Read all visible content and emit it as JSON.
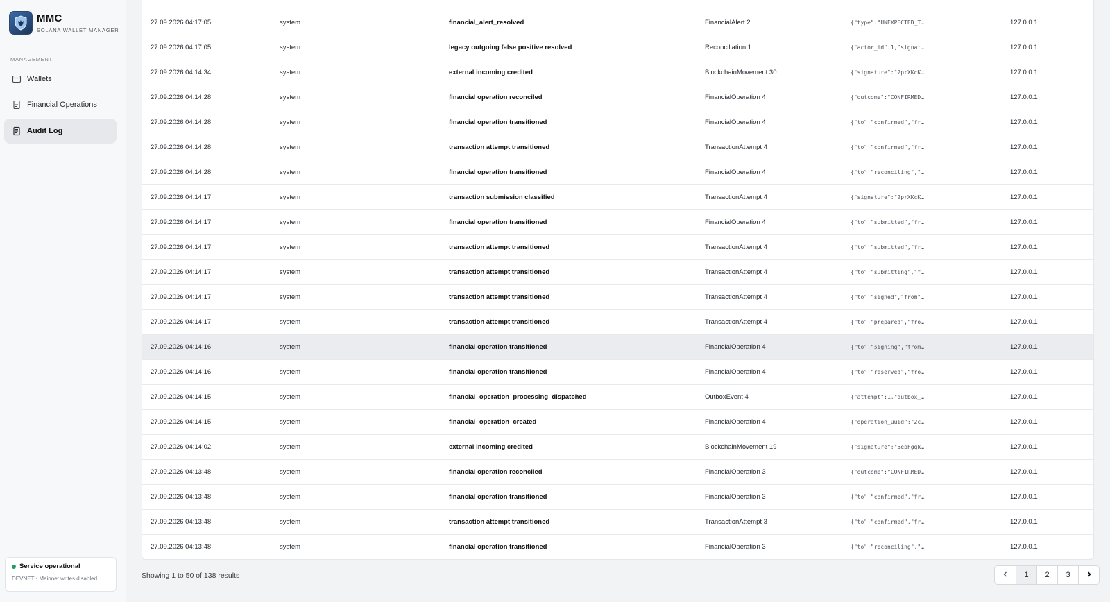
{
  "brand": {
    "title": "MMC",
    "subtitle": "SOLANA WALLET MANAGER",
    "logo_icon": "shield-beast-logo"
  },
  "sidebar": {
    "section_label": "MANAGEMENT",
    "items": [
      {
        "label": "Wallets",
        "icon": "wallet-icon",
        "active": false
      },
      {
        "label": "Financial Operations",
        "icon": "document-icon",
        "active": false
      },
      {
        "label": "Audit Log",
        "icon": "document-icon",
        "active": true
      }
    ]
  },
  "status": {
    "title": "Service operational",
    "subtitle": "DEVNET · Mainnet writes disabled",
    "dot_color": "#1e9e62"
  },
  "audit": {
    "rows": [
      {
        "time": "27.09.2026 04:17:05",
        "actor": "system",
        "action": "financial_alert_resolved",
        "subject": "FinancialAlert 2",
        "metadata": "{\"type\":\"UNEXPECTED_T…",
        "ip": "127.0.0.1"
      },
      {
        "time": "27.09.2026 04:17:05",
        "actor": "system",
        "action": "legacy outgoing false positive resolved",
        "subject": "Reconciliation 1",
        "metadata": "{\"actor_id\":1,\"signat…",
        "ip": "127.0.0.1"
      },
      {
        "time": "27.09.2026 04:14:34",
        "actor": "system",
        "action": "external incoming credited",
        "subject": "BlockchainMovement 30",
        "metadata": "{\"signature\":\"2prXKcK…",
        "ip": "127.0.0.1"
      },
      {
        "time": "27.09.2026 04:14:28",
        "actor": "system",
        "action": "financial operation reconciled",
        "subject": "FinancialOperation 4",
        "metadata": "{\"outcome\":\"CONFIRMED…",
        "ip": "127.0.0.1"
      },
      {
        "time": "27.09.2026 04:14:28",
        "actor": "system",
        "action": "financial operation transitioned",
        "subject": "FinancialOperation 4",
        "metadata": "{\"to\":\"confirmed\",\"fr…",
        "ip": "127.0.0.1"
      },
      {
        "time": "27.09.2026 04:14:28",
        "actor": "system",
        "action": "transaction attempt transitioned",
        "subject": "TransactionAttempt 4",
        "metadata": "{\"to\":\"confirmed\",\"fr…",
        "ip": "127.0.0.1"
      },
      {
        "time": "27.09.2026 04:14:28",
        "actor": "system",
        "action": "financial operation transitioned",
        "subject": "FinancialOperation 4",
        "metadata": "{\"to\":\"reconciling\",\"…",
        "ip": "127.0.0.1"
      },
      {
        "time": "27.09.2026 04:14:17",
        "actor": "system",
        "action": "transaction submission classified",
        "subject": "TransactionAttempt 4",
        "metadata": "{\"signature\":\"2prXKcK…",
        "ip": "127.0.0.1"
      },
      {
        "time": "27.09.2026 04:14:17",
        "actor": "system",
        "action": "financial operation transitioned",
        "subject": "FinancialOperation 4",
        "metadata": "{\"to\":\"submitted\",\"fr…",
        "ip": "127.0.0.1"
      },
      {
        "time": "27.09.2026 04:14:17",
        "actor": "system",
        "action": "transaction attempt transitioned",
        "subject": "TransactionAttempt 4",
        "metadata": "{\"to\":\"submitted\",\"fr…",
        "ip": "127.0.0.1"
      },
      {
        "time": "27.09.2026 04:14:17",
        "actor": "system",
        "action": "transaction attempt transitioned",
        "subject": "TransactionAttempt 4",
        "metadata": "{\"to\":\"submitting\",\"f…",
        "ip": "127.0.0.1"
      },
      {
        "time": "27.09.2026 04:14:17",
        "actor": "system",
        "action": "transaction attempt transitioned",
        "subject": "TransactionAttempt 4",
        "metadata": "{\"to\":\"signed\",\"from\"…",
        "ip": "127.0.0.1"
      },
      {
        "time": "27.09.2026 04:14:17",
        "actor": "system",
        "action": "transaction attempt transitioned",
        "subject": "TransactionAttempt 4",
        "metadata": "{\"to\":\"prepared\",\"fro…",
        "ip": "127.0.0.1"
      },
      {
        "time": "27.09.2026 04:14:16",
        "actor": "system",
        "action": "financial operation transitioned",
        "subject": "FinancialOperation 4",
        "metadata": "{\"to\":\"signing\",\"from…",
        "ip": "127.0.0.1",
        "highlight": true
      },
      {
        "time": "27.09.2026 04:14:16",
        "actor": "system",
        "action": "financial operation transitioned",
        "subject": "FinancialOperation 4",
        "metadata": "{\"to\":\"reserved\",\"fro…",
        "ip": "127.0.0.1"
      },
      {
        "time": "27.09.2026 04:14:15",
        "actor": "system",
        "action": "financial_operation_processing_dispatched",
        "subject": "OutboxEvent 4",
        "metadata": "{\"attempt\":1,\"outbox_…",
        "ip": "127.0.0.1"
      },
      {
        "time": "27.09.2026 04:14:15",
        "actor": "system",
        "action": "financial_operation_created",
        "subject": "FinancialOperation 4",
        "metadata": "{\"operation_uuid\":\"2c…",
        "ip": "127.0.0.1"
      },
      {
        "time": "27.09.2026 04:14:02",
        "actor": "system",
        "action": "external incoming credited",
        "subject": "BlockchainMovement 19",
        "metadata": "{\"signature\":\"5epFgqk…",
        "ip": "127.0.0.1"
      },
      {
        "time": "27.09.2026 04:13:48",
        "actor": "system",
        "action": "financial operation reconciled",
        "subject": "FinancialOperation 3",
        "metadata": "{\"outcome\":\"CONFIRMED…",
        "ip": "127.0.0.1"
      },
      {
        "time": "27.09.2026 04:13:48",
        "actor": "system",
        "action": "financial operation transitioned",
        "subject": "FinancialOperation 3",
        "metadata": "{\"to\":\"confirmed\",\"fr…",
        "ip": "127.0.0.1"
      },
      {
        "time": "27.09.2026 04:13:48",
        "actor": "system",
        "action": "transaction attempt transitioned",
        "subject": "TransactionAttempt 3",
        "metadata": "{\"to\":\"confirmed\",\"fr…",
        "ip": "127.0.0.1"
      },
      {
        "time": "27.09.2026 04:13:48",
        "actor": "system",
        "action": "financial operation transitioned",
        "subject": "FinancialOperation 3",
        "metadata": "{\"to\":\"reconciling\",\"…",
        "ip": "127.0.0.1"
      }
    ]
  },
  "footer": {
    "results_text": "Showing 1 to 50 of 138 results",
    "pages": [
      "1",
      "2",
      "3"
    ],
    "current_page": "1",
    "prev_icon": "chevron-left-icon",
    "next_icon": "chevron-right-icon"
  }
}
